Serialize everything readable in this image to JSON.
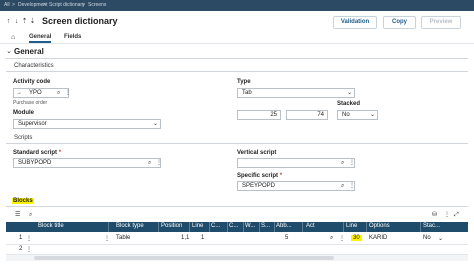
{
  "breadcrumb": {
    "items": [
      "All",
      "Development",
      "Script dictionary",
      "Screens"
    ],
    "sep": ">"
  },
  "header": {
    "title": "Screen dictionary",
    "buttons": {
      "validation": "Validation",
      "copy": "Copy",
      "preview": "Preview"
    }
  },
  "tabs": {
    "general": "General",
    "fields": "Fields"
  },
  "general_section": {
    "title": "General",
    "characteristics": "Characteristics",
    "activity_code": {
      "label": "Activity code",
      "value": "YPO",
      "subtext": "Purchase order"
    },
    "type": {
      "label": "Type",
      "value": "Tab"
    },
    "module": {
      "label": "Module",
      "value": "Supervisor"
    },
    "size": {
      "width": "25",
      "height": "74"
    },
    "stacked": {
      "label": "Stacked",
      "value": "No"
    }
  },
  "scripts": {
    "title": "Scripts",
    "standard": {
      "label": "Standard script",
      "value": "SUBYPOPD"
    },
    "vertical": {
      "label": "Vertical script",
      "value": ""
    },
    "specific": {
      "label": "Specific script",
      "value": "SPEYPOPD"
    }
  },
  "blocks": {
    "label": "Blocks",
    "columns": [
      "Block title",
      "Block type",
      "Position",
      "Line",
      "C...",
      "C...",
      "W...",
      "S...",
      "Abb...",
      "Act",
      "Line",
      "Options",
      "Stac..."
    ],
    "rows": [
      {
        "num": "1",
        "title": "",
        "type": "Table",
        "position": "1,1",
        "line": "1",
        "c1": "",
        "c2": "",
        "w": "",
        "s": "5",
        "abb": "",
        "act": "",
        "line2": "30",
        "options": "KARID",
        "stacked": "No"
      },
      {
        "num": "2",
        "title": "",
        "type": "",
        "position": "",
        "line": "",
        "c1": "",
        "c2": "",
        "w": "",
        "s": "",
        "abb": "",
        "act": "",
        "line2": "",
        "options": "",
        "stacked": ""
      }
    ]
  },
  "colors": {
    "header_bg": "#1f4c6b",
    "accent": "#1f5d8c",
    "highlight": "#fff200",
    "required": "#d23c3c"
  }
}
